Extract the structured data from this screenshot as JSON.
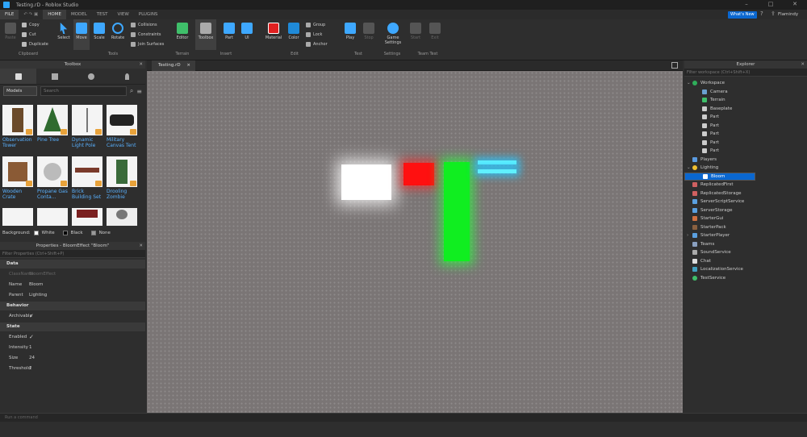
{
  "window": {
    "title": "Testing.rD - Roblox Studio",
    "min": "–",
    "max": "□",
    "close": "✕"
  },
  "menu": {
    "file": "FILE",
    "tabs": [
      "HOME",
      "MODEL",
      "TEST",
      "VIEW",
      "PLUGINS"
    ],
    "whats_new": "What's New",
    "user": "Flamindy"
  },
  "ribbon": {
    "paste": "Paste",
    "copy": "Copy",
    "cut": "Cut",
    "duplicate": "Duplicate",
    "clipboard": "Clipboard",
    "select": "Select",
    "move": "Move",
    "scale": "Scale",
    "rotate": "Rotate",
    "tools": "Tools",
    "collisions": "Collisions",
    "constraints": "Constraints",
    "join_surfaces": "Join Surfaces",
    "editor": "Editor",
    "terrain": "Terrain",
    "toolbox": "Toolbox",
    "part": "Part",
    "ui": "UI",
    "insert": "Insert",
    "material": "Material",
    "color": "Color",
    "group": "Group",
    "lock": "Lock",
    "anchor": "Anchor",
    "edit": "Edit",
    "play": "Play",
    "stop": "Stop",
    "test": "Test",
    "game_settings": "Game Settings",
    "settings": "Settings",
    "start": "Start",
    "test2": "Test",
    "exit": "Exit",
    "game": "Game",
    "team_test": "Team Test"
  },
  "toolbox": {
    "title": "Toolbox",
    "dropdown": "Models",
    "search_placeholder": "Search",
    "assets": [
      {
        "label": "Observation Tower"
      },
      {
        "label": "Pine Tree"
      },
      {
        "label": "Dynamic Light Pole"
      },
      {
        "label": "Military Canvas Tent"
      },
      {
        "label": "Wooden Crate"
      },
      {
        "label": "Propane Gas Conta..."
      },
      {
        "label": "Brick Building Set"
      },
      {
        "label": "Drooling Zombie"
      }
    ],
    "background_label": "Background:",
    "bg_white": "White",
    "bg_black": "Black",
    "bg_none": "None"
  },
  "properties": {
    "title": "Properties - BloomEffect \"Bloom\"",
    "filter": "Filter Properties (Ctrl+Shift+P)",
    "sections": {
      "data": "Data",
      "behavior": "Behavior",
      "state": "State"
    },
    "rows": [
      {
        "k": "ClassName",
        "v": "BloomEffect"
      },
      {
        "k": "Name",
        "v": "Bloom"
      },
      {
        "k": "Parent",
        "v": "Lighting"
      },
      {
        "k": "Archivable",
        "v": "✓"
      },
      {
        "k": "Enabled",
        "v": "✓"
      },
      {
        "k": "Intensity",
        "v": "1"
      },
      {
        "k": "Size",
        "v": "24"
      },
      {
        "k": "Threshold",
        "v": "2"
      }
    ]
  },
  "viewport": {
    "tab": "Testing.rD",
    "tab_close": "×"
  },
  "explorer": {
    "title": "Explorer",
    "filter": "Filter workspace (Ctrl+Shift+X)",
    "items": [
      "Workspace",
      "Camera",
      "Terrain",
      "Baseplate",
      "Part",
      "Part",
      "Part",
      "Part",
      "Part",
      "Players",
      "Lighting",
      "Bloom",
      "ReplicatedFirst",
      "ReplicatedStorage",
      "ServerScriptService",
      "ServerStorage",
      "StarterGui",
      "StarterPack",
      "StarterPlayer",
      "Teams",
      "SoundService",
      "Chat",
      "LocalizationService",
      "TestService"
    ]
  },
  "command_bar": {
    "placeholder": "Run a command"
  }
}
